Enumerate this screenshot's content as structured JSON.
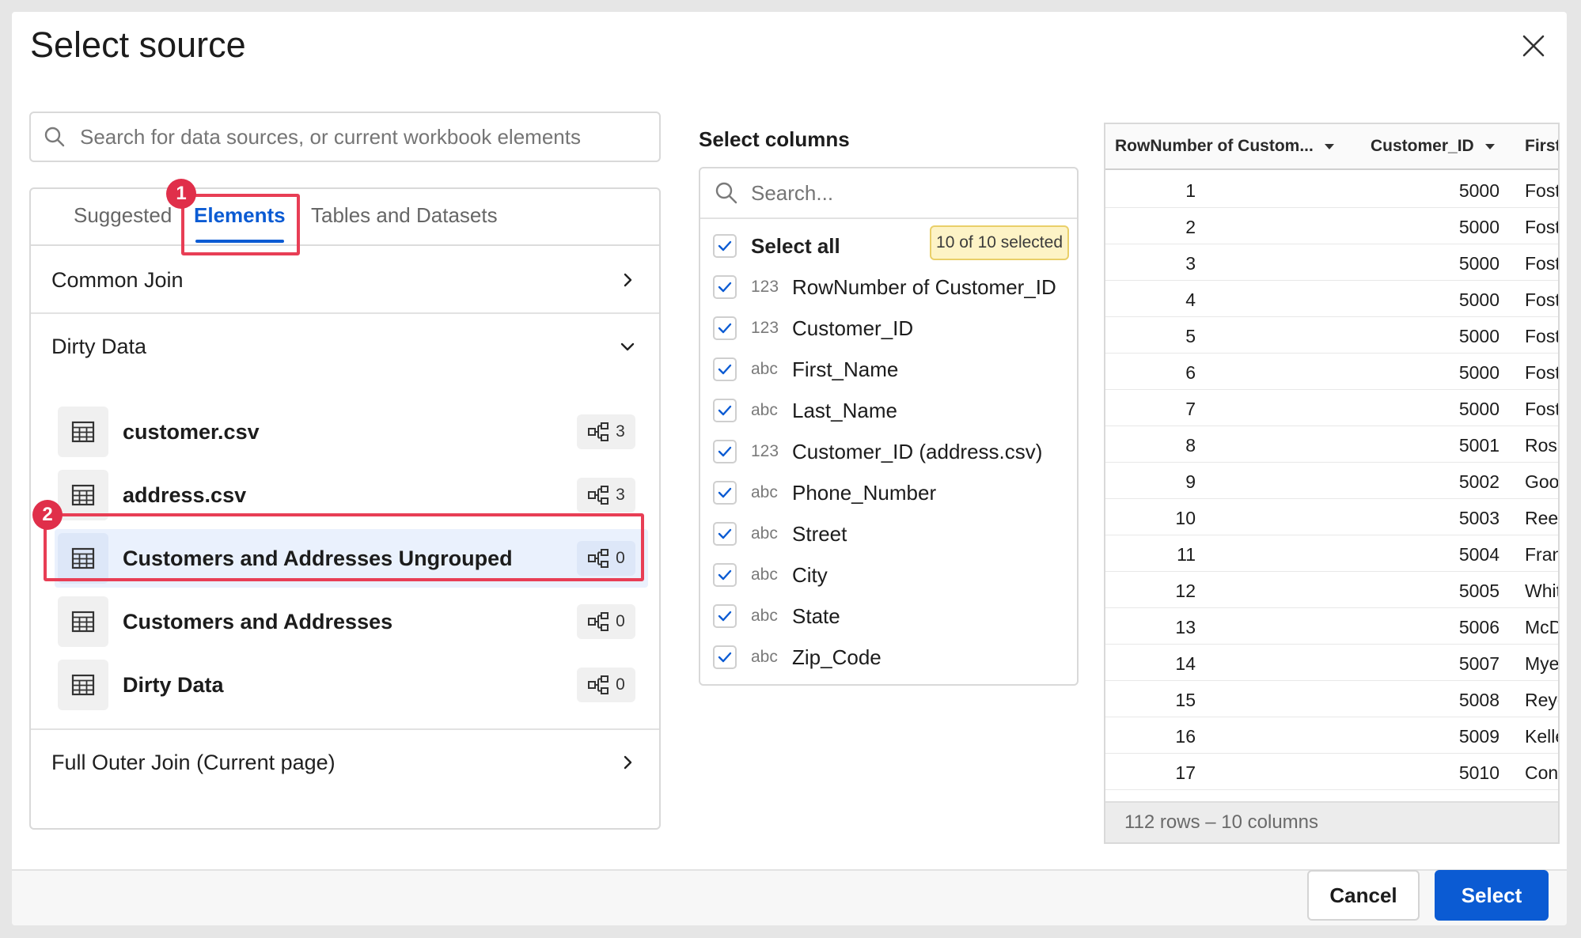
{
  "dialog": {
    "title": "Select source"
  },
  "search": {
    "placeholder": "Search for data sources, or current workbook elements"
  },
  "tabs": [
    {
      "label": "Suggested"
    },
    {
      "label": "Elements",
      "active": true
    },
    {
      "label": "Tables and Datasets"
    }
  ],
  "sections": {
    "common_join": "Common Join",
    "dirty_data": "Dirty Data",
    "full_outer": "Full Outer Join (Current page)"
  },
  "elements": [
    {
      "name": "customer.csv",
      "count": "3"
    },
    {
      "name": "address.csv",
      "count": "3"
    },
    {
      "name": "Customers and Addresses Ungrouped",
      "count": "0",
      "selected": true
    },
    {
      "name": "Customers and Addresses",
      "count": "0"
    },
    {
      "name": "Dirty Data",
      "count": "0"
    }
  ],
  "annotations": {
    "badge1": "1",
    "badge2": "2"
  },
  "columns": {
    "heading": "Select columns",
    "search_placeholder": "Search...",
    "select_all_label": "Select all",
    "selected_badge": "10 of 10 selected",
    "items": [
      {
        "type": "123",
        "name": "RowNumber of Customer_ID"
      },
      {
        "type": "123",
        "name": "Customer_ID"
      },
      {
        "type": "abc",
        "name": "First_Name"
      },
      {
        "type": "abc",
        "name": "Last_Name"
      },
      {
        "type": "123",
        "name": "Customer_ID (address.csv)"
      },
      {
        "type": "abc",
        "name": "Phone_Number"
      },
      {
        "type": "abc",
        "name": "Street"
      },
      {
        "type": "abc",
        "name": "City"
      },
      {
        "type": "abc",
        "name": "State"
      },
      {
        "type": "abc",
        "name": "Zip_Code"
      }
    ]
  },
  "preview": {
    "headers": [
      "RowNumber of Custom...",
      "Customer_ID",
      "First_"
    ],
    "rows": [
      [
        "1",
        "5000",
        "Fost"
      ],
      [
        "2",
        "5000",
        "Fost"
      ],
      [
        "3",
        "5000",
        "Fost"
      ],
      [
        "4",
        "5000",
        "Fost"
      ],
      [
        "5",
        "5000",
        "Fost"
      ],
      [
        "6",
        "5000",
        "Fost"
      ],
      [
        "7",
        "5000",
        "Fost"
      ],
      [
        "8",
        "5001",
        "Rosa"
      ],
      [
        "9",
        "5002",
        "Goo"
      ],
      [
        "10",
        "5003",
        "Reec"
      ],
      [
        "11",
        "5004",
        "Fran"
      ],
      [
        "12",
        "5005",
        "Whit"
      ],
      [
        "13",
        "5006",
        "McD"
      ],
      [
        "14",
        "5007",
        "Mye"
      ],
      [
        "15",
        "5008",
        "Reye"
      ],
      [
        "16",
        "5009",
        "Kelle"
      ],
      [
        "17",
        "5010",
        "Con"
      ]
    ],
    "footer": "112 rows – 10 columns"
  },
  "buttons": {
    "cancel": "Cancel",
    "select": "Select"
  },
  "colors": {
    "accent": "#0b5bd3",
    "annotation": "#e83e55",
    "badge_bg": "#fdf3c6"
  },
  "icons": {
    "search": "search-icon",
    "close": "close-icon",
    "table": "table-icon",
    "lineage": "lineage-icon",
    "chevron_right": "chevron-right-icon",
    "chevron_down": "chevron-down-icon",
    "check": "check-icon",
    "sort": "sort-caret-icon"
  }
}
